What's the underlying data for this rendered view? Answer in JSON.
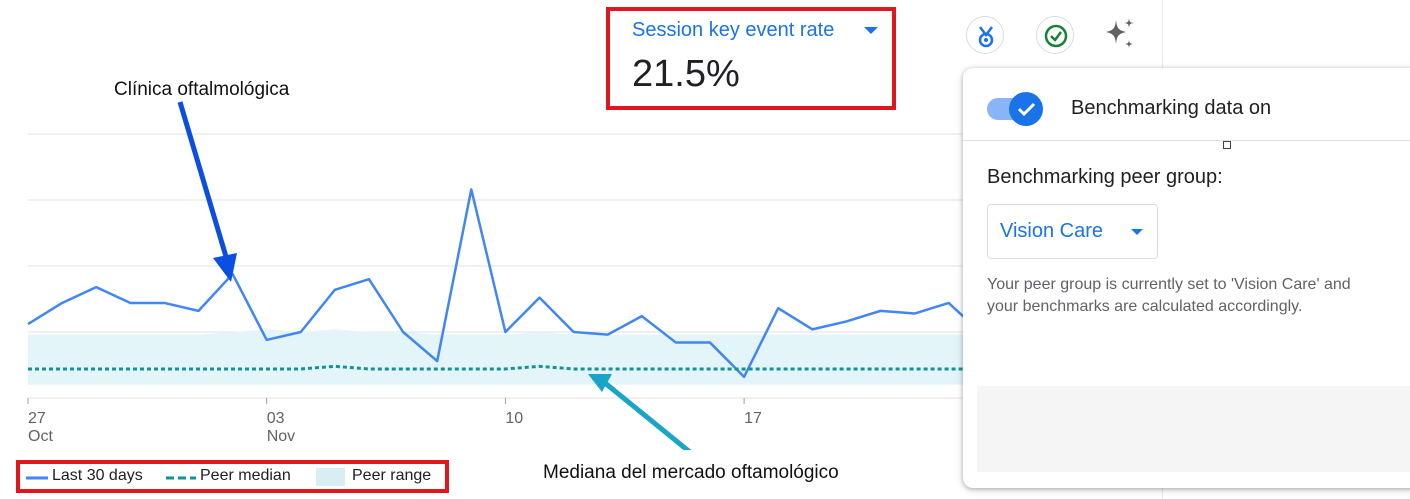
{
  "metric": {
    "label": "Session key event rate",
    "value": "21.5%"
  },
  "header_icons": [
    {
      "name": "benchmark-badge-icon",
      "color": "#1a73e8"
    },
    {
      "name": "check-circle-icon",
      "color": "#188038"
    },
    {
      "name": "sparkle-icon",
      "color": "#5f6368"
    }
  ],
  "annotations": {
    "clinic": "Clínica oftalmológica",
    "median": "Mediana del mercado oftamológico"
  },
  "legend": {
    "last30": "Last 30 days",
    "median": "Peer median",
    "range": "Peer range"
  },
  "panel": {
    "toggle_label": "Benchmarking data on",
    "peer_group_heading": "Benchmarking peer group:",
    "peer_group_value": "Vision Care",
    "description_line1": "Your peer group is currently set to 'Vision Care' and",
    "description_line2": "your benchmarks are calculated accordingly."
  },
  "chart_data": {
    "type": "line",
    "x_ticks": [
      {
        "index": 0,
        "day": "27",
        "month": "Oct"
      },
      {
        "index": 7,
        "day": "03",
        "month": "Nov"
      },
      {
        "index": 14,
        "day": "10",
        "month": ""
      },
      {
        "index": 21,
        "day": "17",
        "month": ""
      }
    ],
    "ylim": [
      0,
      100
    ],
    "grid": true,
    "series": [
      {
        "name": "Last 30 days",
        "color": "#4285f4",
        "values": [
          28,
          36,
          42,
          36,
          36,
          33,
          47,
          22,
          25,
          41,
          45,
          25,
          14,
          79,
          25,
          38,
          25,
          24,
          31,
          21,
          21,
          8,
          34,
          26,
          29,
          33,
          32,
          36,
          24
        ]
      },
      {
        "name": "Peer median",
        "color": "#12939a",
        "values": [
          11,
          11,
          11,
          11,
          11,
          11,
          11,
          11,
          11,
          12,
          11,
          11,
          11,
          11,
          11,
          12,
          11,
          11,
          11,
          11,
          11,
          11,
          11,
          11,
          11,
          11,
          11,
          11,
          11
        ]
      }
    ],
    "peer_range": {
      "name": "Peer range",
      "color": "#e3f5f9",
      "low": [
        5,
        5,
        5,
        5,
        5,
        5,
        5,
        5,
        5,
        5,
        5,
        5,
        5,
        5,
        5,
        5,
        5,
        5,
        5,
        5,
        5,
        5,
        5,
        5,
        5,
        5,
        5,
        5,
        5
      ],
      "high": [
        24,
        24,
        24,
        24,
        24,
        24,
        25,
        26,
        25,
        26,
        25,
        25,
        24,
        24,
        24,
        25,
        24,
        24,
        24,
        24,
        24,
        24,
        24,
        24,
        24,
        24,
        24,
        24,
        24
      ]
    }
  }
}
